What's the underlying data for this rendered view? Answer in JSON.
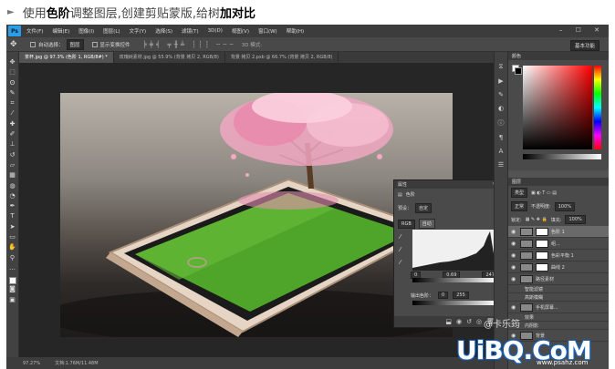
{
  "caption": {
    "prefix": "使用",
    "hl1": "色阶",
    "mid": "调整图层,创建剪贴蒙版,给树",
    "hl2": "加对比"
  },
  "menubar": {
    "logo": "Ps",
    "items": [
      "文件(F)",
      "编辑(E)",
      "图像(I)",
      "图层(L)",
      "文字(Y)",
      "选择(S)",
      "滤镜(T)",
      "3D(D)",
      "视图(V)",
      "窗口(W)",
      "帮助(H)"
    ],
    "window_buttons": "– ☐ ✕"
  },
  "options": {
    "auto_select_label": "自动选择：",
    "auto_select_value": "图层",
    "show_transform": "显示变换控件",
    "mode_3d": "3D 模式:",
    "workspace": "基本功能"
  },
  "tabs": [
    "茶杯.jpg @ 97.3% (色阶 1, RGB/8#) *",
    "玫瑰树素材.jpg @ 55.9% (背景 拷贝 2, RGB/8)",
    "背景 拷贝 2.psb @ 66.7% (背景 拷贝 2, RGB/8)"
  ],
  "status": {
    "zoom": "97.27%",
    "doc": "文档:1.76M/11.48M"
  },
  "levels": {
    "panel_title": "属性",
    "section": "色阶",
    "preset_label": "预设：",
    "preset_value": "自定",
    "channel": "RGB",
    "auto_button": "自动",
    "input_black": "0",
    "input_mid": "0.69",
    "input_white": "247",
    "output_label": "输出色阶：",
    "output_black": "0",
    "output_white": "255"
  },
  "colorpanel": {
    "title": "颜色"
  },
  "layers": {
    "title": "图层",
    "kind": "类型",
    "blend": "正常",
    "opacity_label": "不透明度:",
    "opacity": "100%",
    "lock_label": "锁定:",
    "fill_label": "填充:",
    "fill": "100%",
    "items": [
      {
        "name": "色阶 1",
        "selected": true,
        "sub": false
      },
      {
        "name": "组...",
        "selected": false,
        "sub": false
      },
      {
        "name": "色彩平衡 1",
        "selected": false,
        "sub": false
      },
      {
        "name": "曲线 2",
        "selected": false,
        "sub": false
      },
      {
        "name": "路径素材",
        "selected": false,
        "sub": false
      },
      {
        "name": "智能滤镜",
        "selected": false,
        "sub": true
      },
      {
        "name": "高斯模糊",
        "selected": false,
        "sub": true
      },
      {
        "name": "手机屏幕...",
        "selected": false,
        "sub": false
      },
      {
        "name": "效果",
        "selected": false,
        "sub": true
      },
      {
        "name": "内阴影",
        "selected": false,
        "sub": true
      },
      {
        "name": "背景",
        "selected": false,
        "sub": false
      }
    ]
  },
  "watermark": {
    "small": "@卡乐筠",
    "main": "UiBQ.CoM",
    "url": "www.psahz.com"
  }
}
